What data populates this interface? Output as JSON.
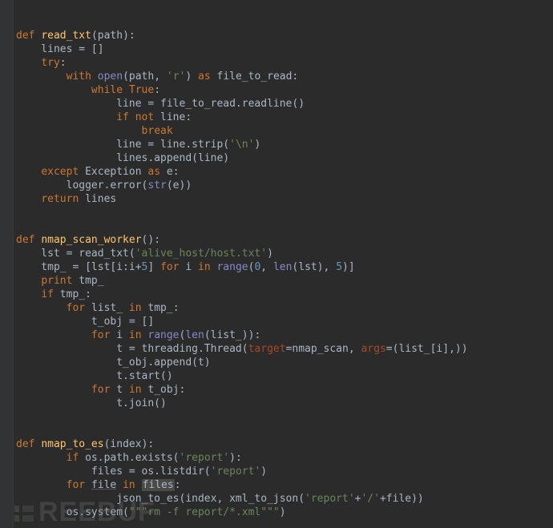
{
  "watermark": {
    "text": "REEBUF"
  },
  "code": {
    "tokens": [
      [
        [
          "kw",
          "def "
        ],
        [
          "fn",
          "read_txt"
        ],
        [
          "op",
          "("
        ],
        [
          "param",
          "path"
        ],
        [
          "op",
          "):"
        ]
      ],
      [
        [
          "op",
          "    lines = []"
        ]
      ],
      [
        [
          "op",
          "    "
        ],
        [
          "kw",
          "try"
        ],
        [
          "op",
          ":"
        ]
      ],
      [
        [
          "op",
          "        "
        ],
        [
          "kw",
          "with "
        ],
        [
          "builtin",
          "open"
        ],
        [
          "op",
          "(path, "
        ],
        [
          "str",
          "'r'"
        ],
        [
          "op",
          ") "
        ],
        [
          "kw",
          "as "
        ],
        [
          "op",
          "file_to_read:"
        ]
      ],
      [
        [
          "op",
          "            "
        ],
        [
          "kw",
          "while "
        ],
        [
          "kw",
          "True"
        ],
        [
          "op",
          ":"
        ]
      ],
      [
        [
          "op",
          "                line = file_to_read.readline()"
        ]
      ],
      [
        [
          "op",
          "                "
        ],
        [
          "kw",
          "if not "
        ],
        [
          "op",
          "line:"
        ]
      ],
      [
        [
          "op",
          "                    "
        ],
        [
          "kw",
          "break"
        ]
      ],
      [
        [
          "op",
          "                line = line.strip("
        ],
        [
          "str",
          "'\\n'"
        ],
        [
          "op",
          ")"
        ]
      ],
      [
        [
          "op",
          "                lines.append(line)"
        ]
      ],
      [
        [
          "op",
          "    "
        ],
        [
          "kw",
          "except "
        ],
        [
          "op",
          "Exception "
        ],
        [
          "kw",
          "as "
        ],
        [
          "op",
          "e:"
        ]
      ],
      [
        [
          "op",
          "        logger.error("
        ],
        [
          "builtin",
          "str"
        ],
        [
          "op",
          "(e))"
        ]
      ],
      [
        [
          "op",
          "    "
        ],
        [
          "kw",
          "return "
        ],
        [
          "op",
          "lines"
        ]
      ],
      [],
      [],
      [
        [
          "kw",
          "def "
        ],
        [
          "fn",
          "nmap_scan_worker"
        ],
        [
          "op",
          "():"
        ]
      ],
      [
        [
          "op",
          "    lst = read_txt("
        ],
        [
          "str",
          "'alive_host/host.txt'"
        ],
        [
          "op",
          ")"
        ]
      ],
      [
        [
          "op",
          "    tmp_ = [lst[i:i+"
        ],
        [
          "num",
          "5"
        ],
        [
          "op",
          "] "
        ],
        [
          "kw",
          "for "
        ],
        [
          "op",
          "i "
        ],
        [
          "kw",
          "in "
        ],
        [
          "builtin",
          "range"
        ],
        [
          "op",
          "("
        ],
        [
          "num",
          "0"
        ],
        [
          "op",
          ", "
        ],
        [
          "builtin",
          "len"
        ],
        [
          "op",
          "(lst), "
        ],
        [
          "num",
          "5"
        ],
        [
          "op",
          ")]"
        ]
      ],
      [
        [
          "op",
          "    "
        ],
        [
          "kw",
          "print "
        ],
        [
          "op",
          "tmp_"
        ]
      ],
      [
        [
          "op",
          "    "
        ],
        [
          "kw",
          "if "
        ],
        [
          "op",
          "tmp_:"
        ]
      ],
      [
        [
          "op",
          "        "
        ],
        [
          "kw",
          "for "
        ],
        [
          "op",
          "list_ "
        ],
        [
          "kw",
          "in "
        ],
        [
          "op",
          "tmp_:"
        ]
      ],
      [
        [
          "op",
          "            t_obj = []"
        ]
      ],
      [
        [
          "op",
          "            "
        ],
        [
          "kw",
          "for "
        ],
        [
          "op",
          "i "
        ],
        [
          "kw",
          "in "
        ],
        [
          "builtin",
          "range"
        ],
        [
          "op",
          "("
        ],
        [
          "builtin",
          "len"
        ],
        [
          "op",
          "(list_)):"
        ]
      ],
      [
        [
          "op",
          "                t = threading.Thread("
        ],
        [
          "kwarg",
          "target"
        ],
        [
          "op",
          "=nmap_scan, "
        ],
        [
          "kwarg",
          "args"
        ],
        [
          "op",
          "=(list_[i],))"
        ]
      ],
      [
        [
          "op",
          "                t_obj.append(t)"
        ]
      ],
      [
        [
          "op",
          "                t.start()"
        ]
      ],
      [
        [
          "op",
          "            "
        ],
        [
          "kw",
          "for "
        ],
        [
          "op",
          "t "
        ],
        [
          "kw",
          "in "
        ],
        [
          "op",
          "t_obj:"
        ]
      ],
      [
        [
          "op",
          "                t.join()"
        ]
      ],
      [],
      [],
      [
        [
          "kw",
          "def "
        ],
        [
          "fn",
          "nmap_to_es"
        ],
        [
          "op",
          "("
        ],
        [
          "param",
          "index"
        ],
        [
          "op",
          "):"
        ]
      ],
      [
        [
          "op",
          "        "
        ],
        [
          "kw",
          "if "
        ],
        [
          "op",
          "os.path.exists("
        ],
        [
          "str",
          "'report'"
        ],
        [
          "op",
          "):"
        ]
      ],
      [
        [
          "op",
          "            files = os.listdir("
        ],
        [
          "str",
          "'report'"
        ],
        [
          "op",
          ")"
        ]
      ],
      [
        [
          "op",
          "        "
        ],
        [
          "kw",
          "for "
        ],
        [
          "ul",
          "file"
        ],
        [
          "op",
          " "
        ],
        [
          "kw",
          "in "
        ],
        [
          "hl",
          "files"
        ],
        [
          "op",
          ":"
        ]
      ],
      [
        [
          "op",
          "                json_to_es(index, xml_to_json("
        ],
        [
          "str",
          "'report'"
        ],
        [
          "op",
          "+"
        ],
        [
          "str",
          "'/'"
        ],
        [
          "op",
          "+file))"
        ]
      ],
      [
        [
          "op",
          "        os.system("
        ],
        [
          "str",
          "\"\"\"rm -f report/*.xml\"\"\""
        ],
        [
          "op",
          ")"
        ]
      ]
    ]
  }
}
